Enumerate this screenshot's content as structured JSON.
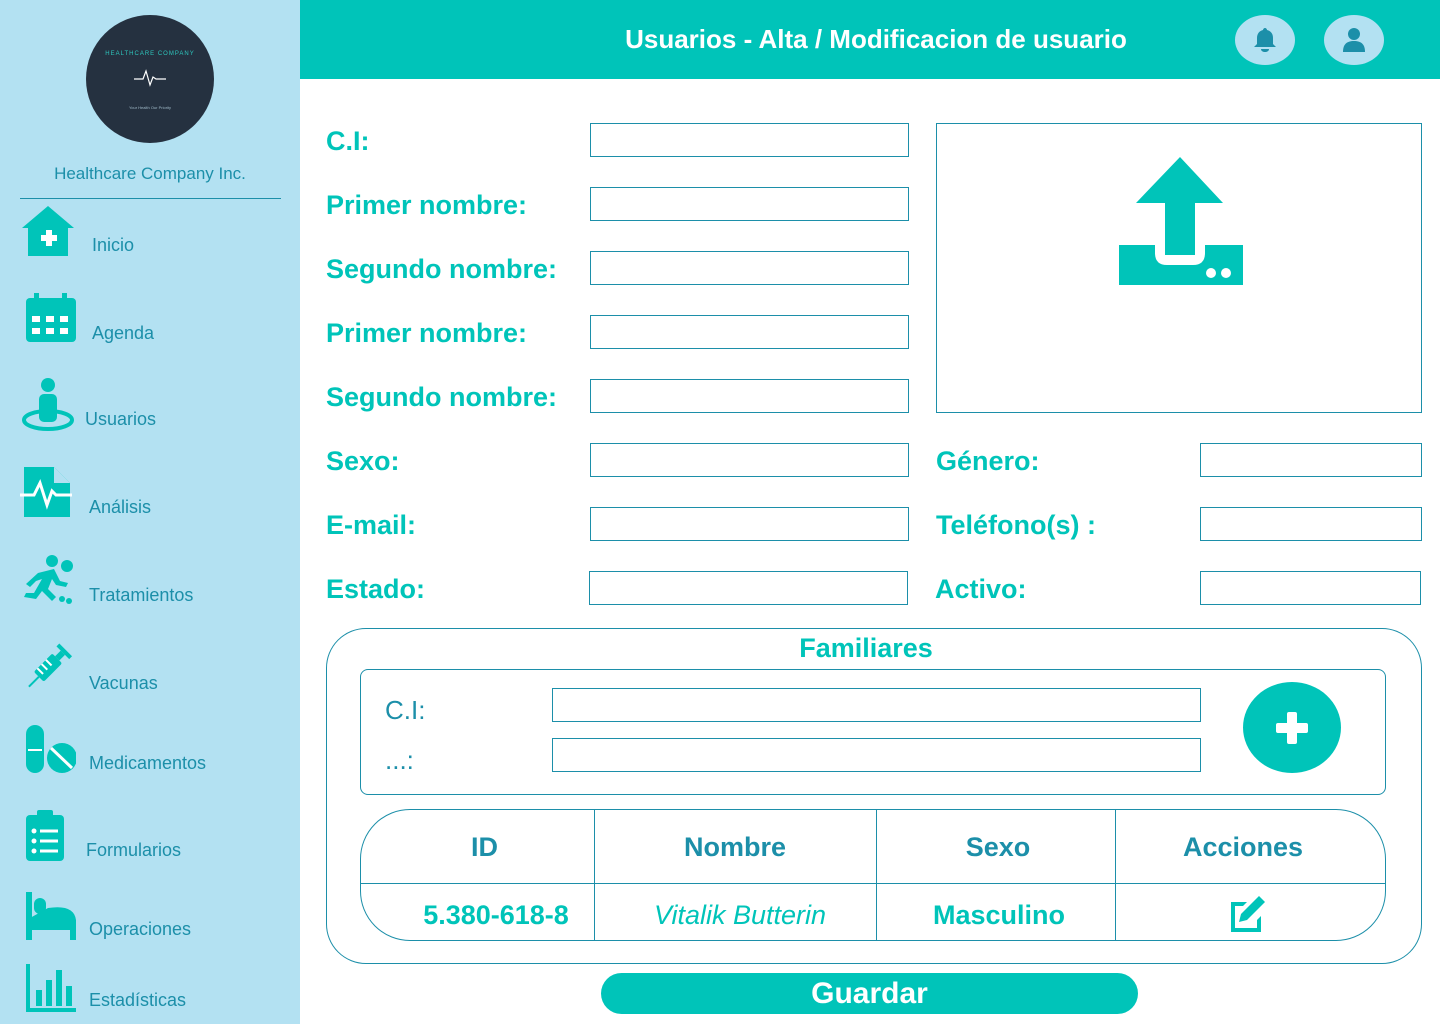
{
  "sidebar": {
    "company_name": "Healthcare Company Inc.",
    "logo_text": "HEALTHCARE COMPANY",
    "logo_tagline": "Your Health Our Priority",
    "items": [
      {
        "label": "Inicio",
        "icon": "home-medical-icon"
      },
      {
        "label": "Agenda",
        "icon": "calendar-icon"
      },
      {
        "label": "Usuarios",
        "icon": "user-pin-icon"
      },
      {
        "label": "Análisis",
        "icon": "pulse-file-icon"
      },
      {
        "label": "Tratamientos",
        "icon": "running-person-icon"
      },
      {
        "label": "Vacunas",
        "icon": "syringe-icon"
      },
      {
        "label": "Medicamentos",
        "icon": "pills-icon"
      },
      {
        "label": "Formularios",
        "icon": "clipboard-list-icon"
      },
      {
        "label": "Operaciones",
        "icon": "hospital-bed-icon"
      },
      {
        "label": "Estadísticas",
        "icon": "bar-chart-icon"
      }
    ]
  },
  "header": {
    "title": "Usuarios - Alta / Modificacion de usuario",
    "notification_icon": "bell-icon",
    "profile_icon": "user-icon"
  },
  "form": {
    "ci_label": "C.I:",
    "first_name_label": "Primer nombre:",
    "second_name_label": "Segundo nombre:",
    "first_name_label_2": "Primer nombre:",
    "second_name_label_2": "Segundo nombre:",
    "sex_label": "Sexo:",
    "email_label": "E-mail:",
    "status_label": "Estado:",
    "gender_label": "Género:",
    "phone_label": "Teléfono(s) :",
    "active_label": "Activo:",
    "ci_value": "",
    "first_name_value": "",
    "second_name_value": "",
    "first_name_value_2": "",
    "second_name_value_2": "",
    "sex_value": "",
    "email_value": "",
    "status_value": "",
    "gender_value": "",
    "phone_value": "",
    "active_value": "",
    "upload_icon": "upload-icon"
  },
  "familiares": {
    "title": "Familiares",
    "ci_label": "C.I:",
    "other_label": "...:",
    "ci_value": "",
    "other_value": "",
    "add_icon": "plus-icon",
    "table": {
      "headers": [
        "ID",
        "Nombre",
        "Sexo",
        "Acciones"
      ],
      "rows": [
        {
          "id": "5.380-618-8",
          "name": "Vitalik Butterin",
          "sex": "Masculino",
          "action_icon": "edit-icon"
        }
      ]
    }
  },
  "save_label": "Guardar",
  "colors": {
    "accent": "#00c4b9",
    "sidebar": "#b3e1f2",
    "text_dark": "#1c8fa9",
    "logo_bg": "#253140"
  }
}
